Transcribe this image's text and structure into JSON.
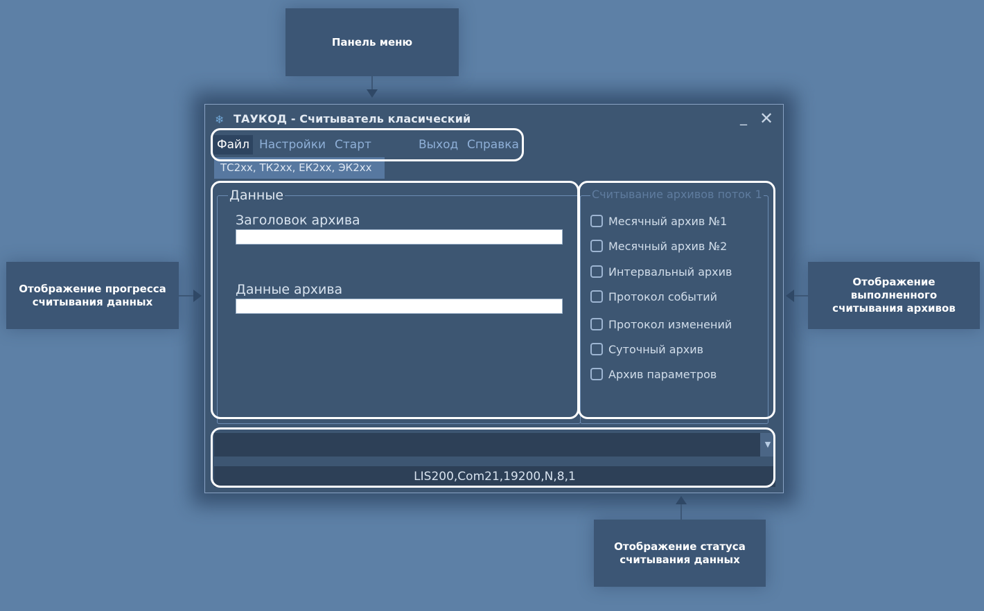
{
  "callouts": {
    "menu_panel": "Панель меню",
    "progress": "Отображение прогресса\nсчитывания данных",
    "archives_done": "Отображение\nвыполненного\nсчитывания архивов",
    "status": "Отображение статуса\nсчитывания данных"
  },
  "window": {
    "title": "ТАУКОД - Считыватель класический",
    "minimize_glyph": "_",
    "close_glyph": "✕"
  },
  "menu": {
    "file": "Файл",
    "settings": "Настройки",
    "start": "Старт",
    "exit": "Выход",
    "help": "Справка"
  },
  "device_tab": "ТС2хх, ТК2хх, ЕК2хх, ЭК2хх",
  "data_group": {
    "title": "Данные",
    "archive_header_label": "Заголовок архива",
    "archive_header_value": "",
    "archive_data_label": "Данные архива",
    "archive_data_value": ""
  },
  "archives_group": {
    "title": "Считывание архивов поток 1",
    "items": [
      {
        "label": "Месячный архив №1",
        "checked": false
      },
      {
        "label": "Месячный архив №2",
        "checked": false
      },
      {
        "label": "Интервальный архив",
        "checked": false
      },
      {
        "label": "Протокол событий",
        "checked": false
      },
      {
        "label": "Протокол изменений",
        "checked": false
      },
      {
        "label": "Суточный архив",
        "checked": false
      },
      {
        "label": "Архив параметров",
        "checked": false
      }
    ]
  },
  "combo": {
    "value": "",
    "dropdown_glyph": "▼"
  },
  "status_line": "LIS200,Com21,19200,N,8,1",
  "colors": {
    "background": "#5d80a6",
    "window": "#3d5672",
    "callout": "#3c5675",
    "highlight": "#ffffff"
  },
  "icons": {
    "app": "snowflake-icon"
  }
}
